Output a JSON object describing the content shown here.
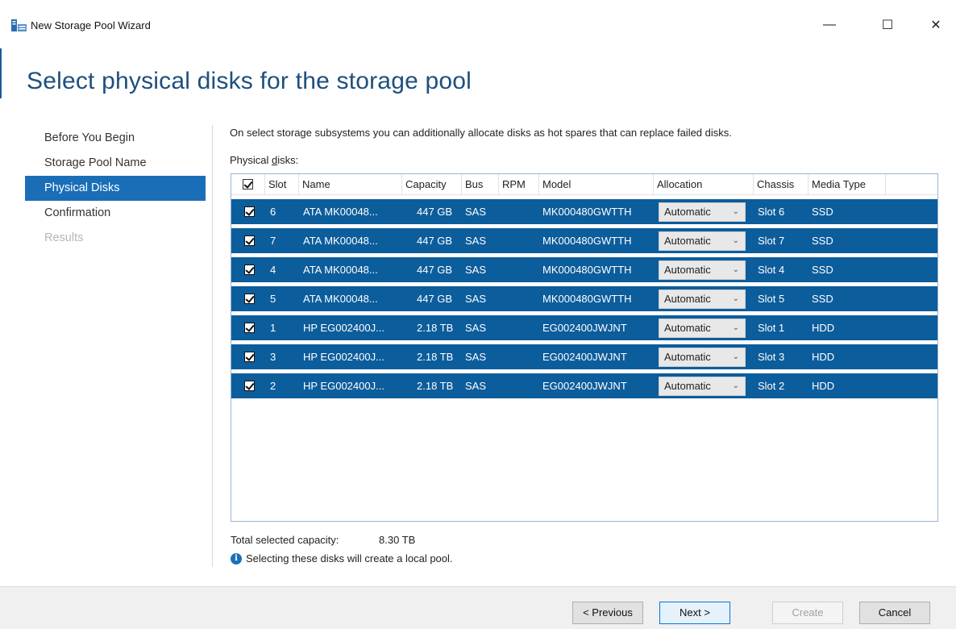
{
  "window": {
    "title": "New Storage Pool Wizard",
    "minimize": "—",
    "maximize": "☐",
    "close": "✕"
  },
  "page_title": "Select physical disks for the storage pool",
  "steps": [
    {
      "label": "Before You Begin",
      "state": "normal"
    },
    {
      "label": "Storage Pool Name",
      "state": "normal"
    },
    {
      "label": "Physical Disks",
      "state": "active"
    },
    {
      "label": "Confirmation",
      "state": "normal"
    },
    {
      "label": "Results",
      "state": "disabled"
    }
  ],
  "description": "On select storage subsystems you can additionally allocate disks as hot spares that can replace failed disks.",
  "list_label_pre": "Physical ",
  "list_label_accel": "d",
  "list_label_post": "isks:",
  "columns": {
    "slot": "Slot",
    "name": "Name",
    "capacity": "Capacity",
    "bus": "Bus",
    "rpm": "RPM",
    "model": "Model",
    "allocation": "Allocation",
    "chassis": "Chassis",
    "media_type": "Media Type"
  },
  "disks": [
    {
      "slot": "6",
      "name": "ATA MK00048...",
      "capacity": "447 GB",
      "bus": "SAS",
      "rpm": "",
      "model": "MK000480GWTTH",
      "allocation": "Automatic",
      "chassis": "Slot 6",
      "media_type": "SSD",
      "checked": true
    },
    {
      "slot": "7",
      "name": "ATA MK00048...",
      "capacity": "447 GB",
      "bus": "SAS",
      "rpm": "",
      "model": "MK000480GWTTH",
      "allocation": "Automatic",
      "chassis": "Slot 7",
      "media_type": "SSD",
      "checked": true
    },
    {
      "slot": "4",
      "name": "ATA MK00048...",
      "capacity": "447 GB",
      "bus": "SAS",
      "rpm": "",
      "model": "MK000480GWTTH",
      "allocation": "Automatic",
      "chassis": "Slot 4",
      "media_type": "SSD",
      "checked": true
    },
    {
      "slot": "5",
      "name": "ATA MK00048...",
      "capacity": "447 GB",
      "bus": "SAS",
      "rpm": "",
      "model": "MK000480GWTTH",
      "allocation": "Automatic",
      "chassis": "Slot 5",
      "media_type": "SSD",
      "checked": true
    },
    {
      "slot": "1",
      "name": "HP EG002400J...",
      "capacity": "2.18 TB",
      "bus": "SAS",
      "rpm": "",
      "model": "EG002400JWJNT",
      "allocation": "Automatic",
      "chassis": "Slot 1",
      "media_type": "HDD",
      "checked": true
    },
    {
      "slot": "3",
      "name": "HP EG002400J...",
      "capacity": "2.18 TB",
      "bus": "SAS",
      "rpm": "",
      "model": "EG002400JWJNT",
      "allocation": "Automatic",
      "chassis": "Slot 3",
      "media_type": "HDD",
      "checked": true
    },
    {
      "slot": "2",
      "name": "HP EG002400J...",
      "capacity": "2.18 TB",
      "bus": "SAS",
      "rpm": "",
      "model": "EG002400JWJNT",
      "allocation": "Automatic",
      "chassis": "Slot 2",
      "media_type": "HDD",
      "checked": true
    }
  ],
  "total_capacity_label": "Total selected capacity:",
  "total_capacity_value": "8.30 TB",
  "info_text": "Selecting these disks will create a local pool.",
  "buttons": {
    "previous": "< Previous",
    "next": "Next >",
    "create": "Create",
    "cancel": "Cancel"
  },
  "colors": {
    "accent": "#1a6eb8",
    "row_selected": "#0c5d9c",
    "title_blue": "#1e4f7d"
  }
}
